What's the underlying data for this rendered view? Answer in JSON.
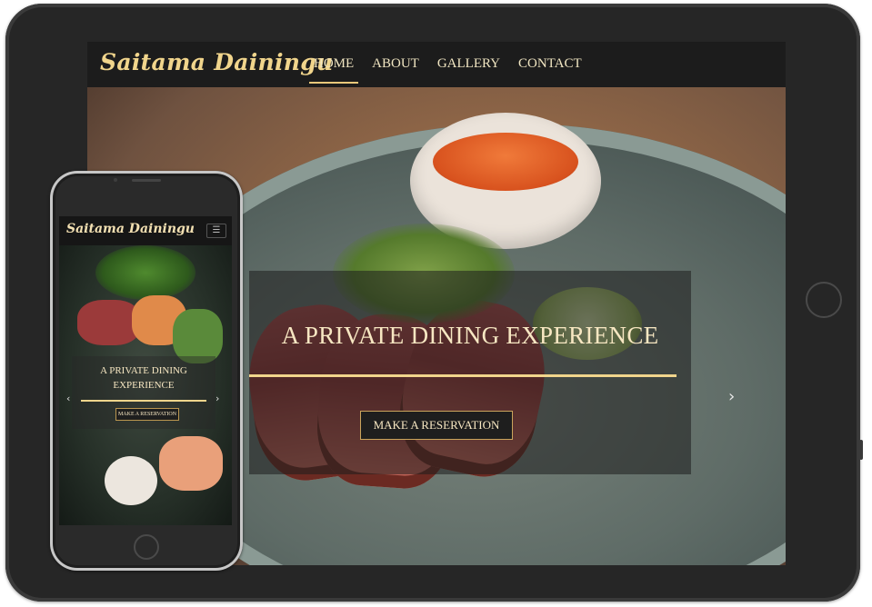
{
  "site": {
    "name": "Saitama Dainingu"
  },
  "nav": {
    "items": [
      {
        "label": "HOME",
        "active": true
      },
      {
        "label": "ABOUT",
        "active": false
      },
      {
        "label": "GALLERY",
        "active": false
      },
      {
        "label": "CONTACT",
        "active": false
      }
    ]
  },
  "hero": {
    "heading": "A PRIVATE DINING EXPERIENCE",
    "cta_label": "MAKE A RESERVATION",
    "next_icon": "chevron-right-icon",
    "prev_icon": "chevron-left-icon"
  },
  "mobile": {
    "menu_icon": "hamburger-menu-icon"
  },
  "colors": {
    "accent": "#f1d58c",
    "nav_bg": "#1c1c1c",
    "device_frame": "#262626"
  }
}
